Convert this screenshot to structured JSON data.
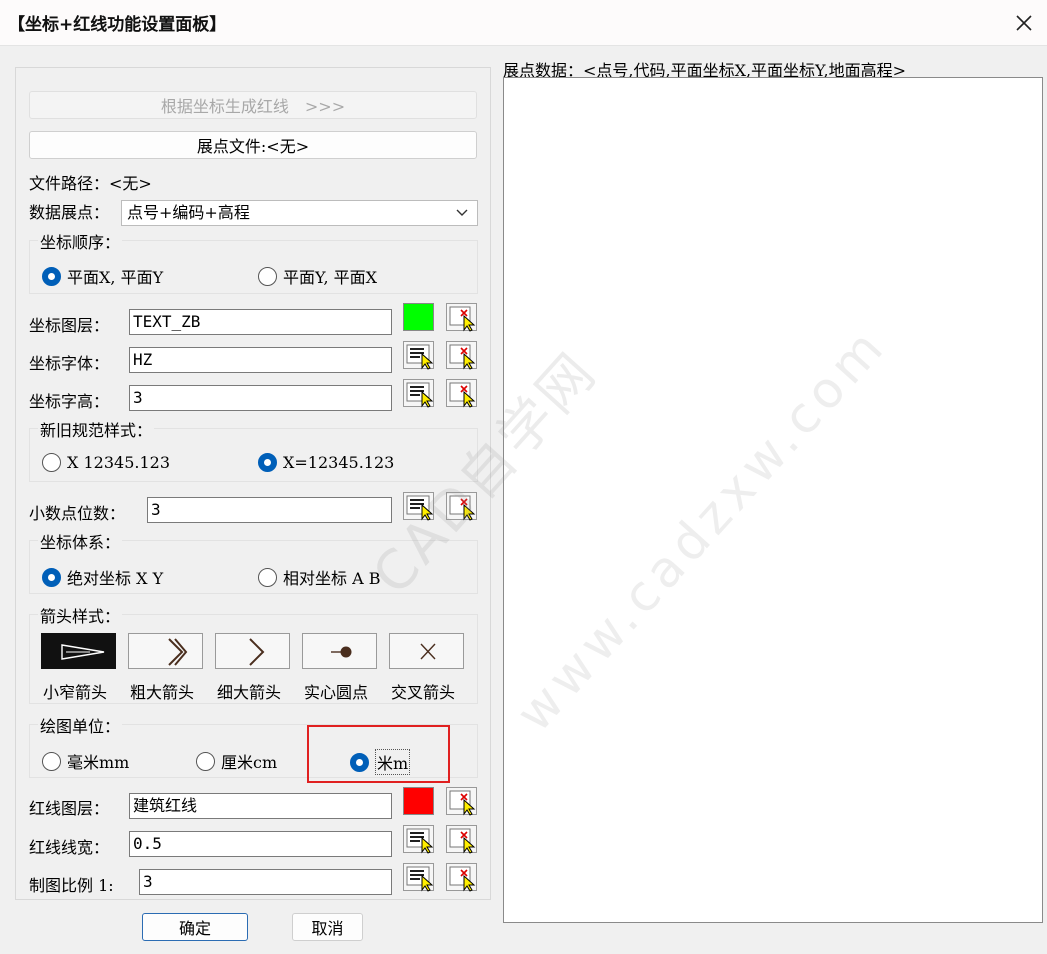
{
  "window": {
    "title": "【坐标+红线功能设置面板】"
  },
  "generate_button": "根据坐标生成红线　>>>",
  "file_button": "展点文件:<无>",
  "file_path_label": "文件路径：<无>",
  "data_plot": {
    "label": "数据展点：",
    "selected": "点号+编码+高程"
  },
  "coord_order": {
    "title": "坐标顺序：",
    "options": [
      "平面X, 平面Y",
      "平面Y, 平面X"
    ],
    "selected": 0
  },
  "layer": {
    "label": "坐标图层：",
    "value": "TEXT_ZB",
    "color": "#00ff00"
  },
  "font": {
    "label": "坐标字体：",
    "value": "HZ"
  },
  "text_height": {
    "label": "坐标字高：",
    "value": "3"
  },
  "style": {
    "title": "新旧规范样式：",
    "options": [
      "X 12345.123",
      "X=12345.123"
    ],
    "selected": 1
  },
  "decimals": {
    "label": "小数点位数：",
    "value": "3"
  },
  "coord_system": {
    "title": "坐标体系：",
    "options": [
      "绝对坐标 X Y",
      "相对坐标 A B"
    ],
    "selected": 0
  },
  "arrow_style": {
    "title": "箭头样式：",
    "options": [
      "小窄箭头",
      "粗大箭头",
      "细大箭头",
      "实心圆点",
      "交叉箭头"
    ],
    "selected": 0
  },
  "unit": {
    "title": "绘图单位：",
    "options": [
      "毫米mm",
      "厘米cm",
      "米m"
    ],
    "selected": 2
  },
  "red_layer": {
    "label": "红线图层：",
    "value": "建筑红线",
    "color": "#ff0000"
  },
  "red_width": {
    "label": "红线线宽：",
    "value": "0.5"
  },
  "scale": {
    "label": "制图比例 1:",
    "value": "3"
  },
  "ok_button": "确定",
  "cancel_button": "取消",
  "data_panel_label": "展点数据：<点号,代码,平面坐标X,平面坐标Y,地面高程>",
  "watermark": {
    "line1": "CAD自学网",
    "line2": "www.cadzxw.com"
  }
}
